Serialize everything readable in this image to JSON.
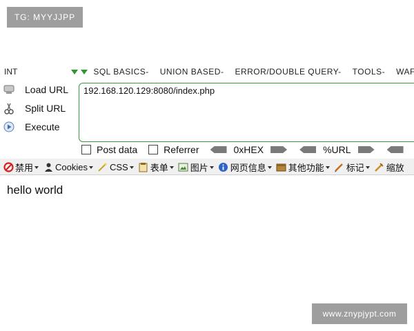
{
  "watermarks": {
    "top": "TG: MYYJJPP",
    "bottom": "www.znypjypt.com"
  },
  "menu_strip": {
    "int_label": "INT",
    "items": [
      "SQL BASICS-",
      "UNION BASED-",
      "ERROR/DOUBLE QUERY-",
      "TOOLS-",
      "WAF"
    ]
  },
  "hackbar": {
    "side_items": [
      {
        "label": "Load URL",
        "icon": "load-url-icon"
      },
      {
        "label": "Split URL",
        "icon": "split-url-icon"
      },
      {
        "label": "Execute",
        "icon": "execute-icon"
      }
    ],
    "url_value": "192.168.120.129:8080/index.php",
    "options": {
      "post_data": "Post data",
      "referrer": "Referrer"
    },
    "encoders": [
      "0xHEX",
      "%URL"
    ]
  },
  "toolbar": {
    "items": [
      {
        "label": "禁用",
        "icon": "disable-icon"
      },
      {
        "label": "Cookies",
        "icon": "cookies-icon"
      },
      {
        "label": "CSS",
        "icon": "css-icon"
      },
      {
        "label": "表单",
        "icon": "forms-icon"
      },
      {
        "label": "图片",
        "icon": "images-icon"
      },
      {
        "label": "网页信息",
        "icon": "info-icon"
      },
      {
        "label": "其他功能",
        "icon": "misc-icon"
      },
      {
        "label": "标记",
        "icon": "outline-icon"
      },
      {
        "label": "缩放",
        "icon": "resize-icon"
      }
    ]
  },
  "page": {
    "content_text": "hello world"
  },
  "colors": {
    "url_border": "#3a9a3a",
    "watermark_bg": "#9e9e9e",
    "toolbar_bg": "#f0f0f0"
  }
}
